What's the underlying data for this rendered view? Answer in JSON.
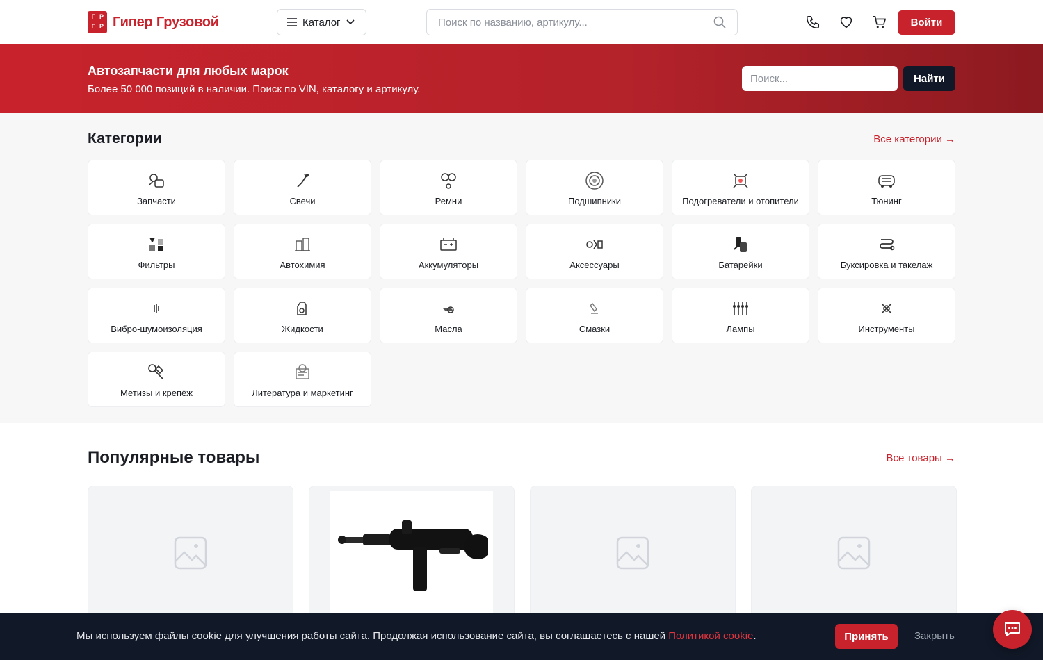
{
  "header": {
    "logo_text": "Гипер Грузовой",
    "logo_letters": [
      "Г",
      "Р",
      "Г",
      "Р"
    ],
    "catalog_label": "Каталог",
    "search_placeholder": "Поиск по названию, артикулу...",
    "login_label": "Войти",
    "icons": [
      "phone-icon",
      "heart-icon",
      "cart-icon"
    ]
  },
  "hero": {
    "title": "Автозапчасти для любых марок",
    "subtitle": "Более 50 000 позиций в наличии. Поиск по VIN, каталогу и артикулу.",
    "search_placeholder": "Поиск...",
    "search_button": "Найти"
  },
  "categories": {
    "title": "Категории",
    "all_link": "Все категории →",
    "items": [
      {
        "label": "Запчасти",
        "icon": "parts-icon"
      },
      {
        "label": "Свечи",
        "icon": "spark-plug-icon"
      },
      {
        "label": "Ремни",
        "icon": "belt-icon"
      },
      {
        "label": "Подшипники",
        "icon": "bearing-icon"
      },
      {
        "label": "Подогреватели и отопители",
        "icon": "heater-icon"
      },
      {
        "label": "Тюнинг",
        "icon": "tuning-icon"
      },
      {
        "label": "Фильтры",
        "icon": "filter-icon"
      },
      {
        "label": "Автохимия",
        "icon": "chemistry-icon"
      },
      {
        "label": "Аккумуляторы",
        "icon": "battery-icon"
      },
      {
        "label": "Аксессуары",
        "icon": "accessories-icon"
      },
      {
        "label": "Батарейки",
        "icon": "batteries-icon"
      },
      {
        "label": "Буксировка и такелаж",
        "icon": "towing-icon"
      },
      {
        "label": "Вибро-шумоизоляция",
        "icon": "soundproof-icon"
      },
      {
        "label": "Жидкости",
        "icon": "fluids-icon"
      },
      {
        "label": "Масла",
        "icon": "oil-icon"
      },
      {
        "label": "Смазки",
        "icon": "grease-icon"
      },
      {
        "label": "Лампы",
        "icon": "lamp-icon"
      },
      {
        "label": "Инструменты",
        "icon": "tools-icon"
      },
      {
        "label": "Метизы и крепёж",
        "icon": "fasteners-icon"
      },
      {
        "label": "Литература и маркетинг",
        "icon": "literature-icon"
      }
    ]
  },
  "popular": {
    "title": "Популярные товары",
    "all_link": "Все товары →"
  },
  "cookie": {
    "text": "Мы используем файлы cookie для улучшения работы сайта. Продолжая использование сайта, вы соглашаетесь с нашей ",
    "link": "Политикой cookie",
    "end": ".",
    "accept": "Принять",
    "close": "Закрыть"
  },
  "colors": {
    "accent": "#c8232c",
    "dark": "#111827",
    "bg_section": "#f7f7f8"
  }
}
